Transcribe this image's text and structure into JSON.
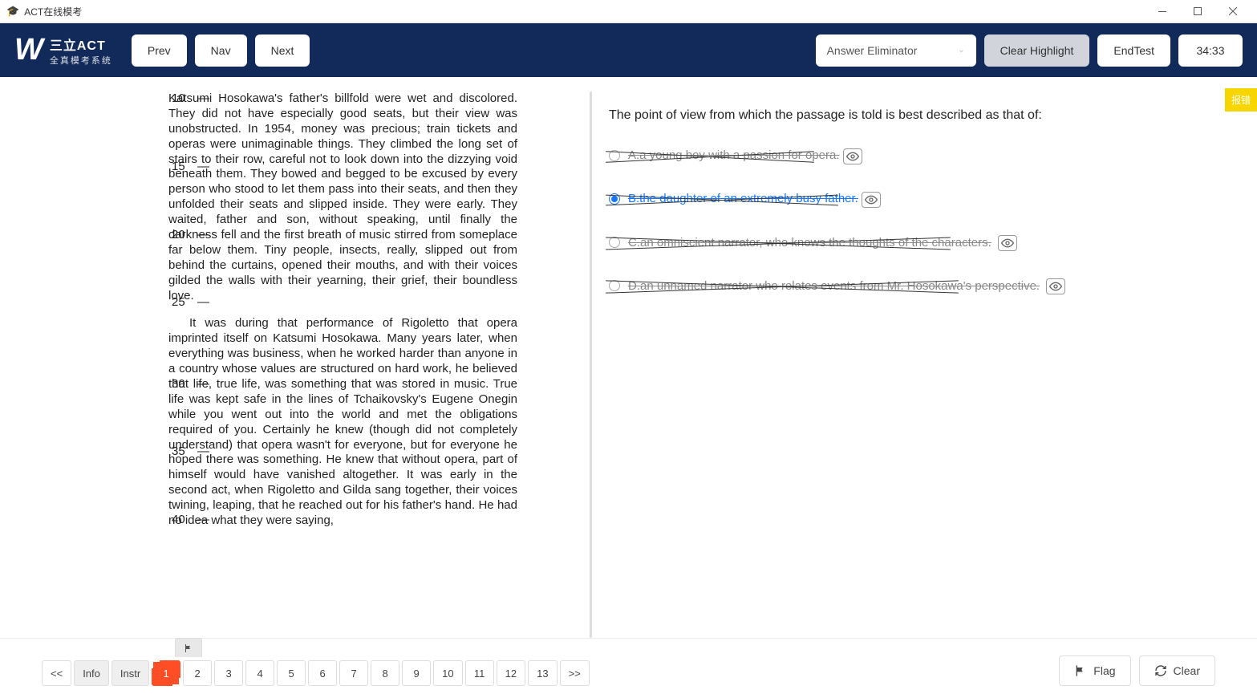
{
  "window": {
    "title": "ACT在线模考"
  },
  "header": {
    "brand_top": "三立ACT",
    "brand_sub": "全真模考系统",
    "prev": "Prev",
    "nav": "Nav",
    "next": "Next",
    "eliminator": "Answer Eliminator",
    "clear_highlight": "Clear Highlight",
    "end_test": "EndTest",
    "timer": "34:33"
  },
  "report_btn": "报错",
  "passage": {
    "line_numbers": [
      "10",
      "15",
      "20",
      "25",
      "30",
      "35",
      "40"
    ],
    "para1": "Katsumi Hosokawa's father's billfold were wet and discolored. They did not have especially good seats, but their view was unobstructed. In 1954, money was precious; train tickets and operas were unimaginable things. They climbed the long set of stairs to their row, careful not to look down into the dizzying void beneath them. They bowed and begged to be excused by every person who stood to let them pass into their seats, and then they unfolded their seats and slipped inside. They were early. They waited, father and son, without speaking, until finally the darkness fell and the first breath of music stirred from someplace far below them. Tiny people, insects, really, slipped out from behind the curtains, opened their mouths, and with their voices gilded the walls with their yearning, their grief, their boundless love.",
    "para2": "It was during that performance of Rigoletto that opera imprinted itself on Katsumi Hosokawa. Many years later, when everything was business, when he worked harder than anyone in a country whose values are structured on hard work, he believed that life, true life, was something that was stored in music. True life was kept safe in the lines of Tchaikovsky's Eugene Onegin while you went out into the world and met the obligations required of you. Certainly he knew (though did not completely understand) that opera wasn't for everyone, but for everyone he hoped there was something. He knew that without opera, part of himself would have vanished altogether. It was early in the second act, when Rigoletto and Gilda sang together, their voices twining, leaping, that he reached out for his father's hand. He had no idea what they were saying,"
  },
  "question": {
    "stem": "The point of view from which the passage is told is best described as that of:",
    "choices": {
      "a": "A.a young boy with a passion for opera.",
      "b": "B.the daughter of an extremely busy father.",
      "c": "C.an omniscient narrator, who knows the thoughts of the characters.",
      "d": "D.an unnamed narrator who relates events from Mr. Hosokawa's perspective."
    }
  },
  "footer": {
    "first": "<<",
    "info": "Info",
    "instr": "Instr",
    "nums": [
      "1",
      "2",
      "3",
      "4",
      "5",
      "6",
      "7",
      "8",
      "9",
      "10",
      "11",
      "12",
      "13"
    ],
    "last": ">>",
    "flag": "Flag",
    "clear": "Clear"
  }
}
